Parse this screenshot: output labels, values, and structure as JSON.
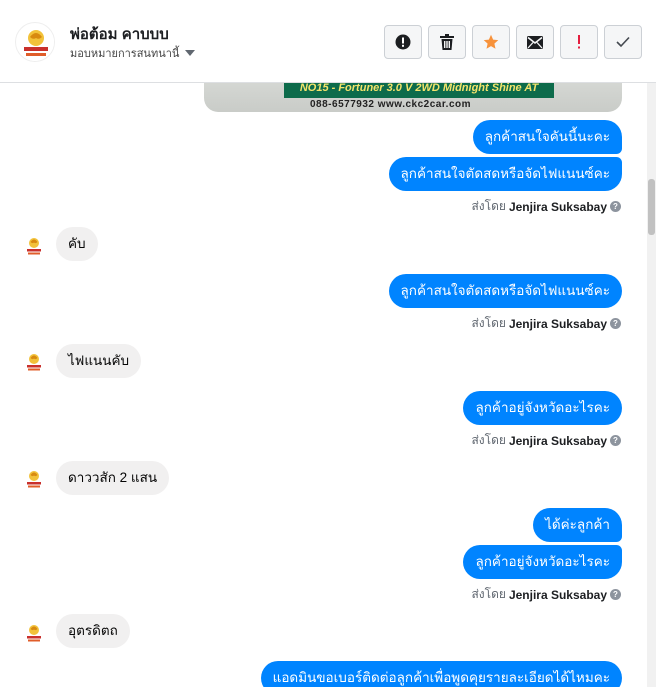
{
  "header": {
    "title": "พ่อต้อม คาบบบ",
    "subtitle": "มอบหมายการสนทนานี้",
    "icons": {
      "avatar": "dealer-logo-icon",
      "assign_dropdown": "caret-down-icon"
    },
    "toolbar": [
      {
        "name": "report-button",
        "icon": "alert-circle-icon"
      },
      {
        "name": "delete-button",
        "icon": "trash-icon"
      },
      {
        "name": "star-button",
        "icon": "star-icon"
      },
      {
        "name": "mark-unread-button",
        "icon": "envelope-icon"
      },
      {
        "name": "spam-button",
        "icon": "exclamation-icon"
      },
      {
        "name": "mark-done-button",
        "icon": "check-icon"
      }
    ]
  },
  "banner": {
    "line1": "NO15 - Fortuner 3.0 V 2WD Midnight Shine AT",
    "line2": "088-6577932  www.ckc2car.com"
  },
  "sentby_prefix": "ส่งโดย",
  "sender_name": "Jenjira Suksabay",
  "messages": {
    "m1": "ลูกค้าสนใจคันนี้นะคะ",
    "m2": "ลูกค้าสนใจตัดสดหรือจัดไฟแนนซ์คะ",
    "r1": "คับ",
    "m3": "ลูกค้าสนใจตัดสดหรือจัดไฟแนนซ์คะ",
    "r2": "ไฟแนนคับ",
    "m4": "ลูกค้าอยู่จังหวัดอะไรคะ",
    "r3": "ดาววสัก 2 แสน",
    "m5": "ได้ค่ะลูกค้า",
    "m6": "ลูกค้าอยู่จังหวัดอะไรคะ",
    "r4": "อุตรดิตถ",
    "m7": "แอดมินขอเบอร์ติดต่อลูกค้าเพื่อพูดคุยรายละเอียดได้ไหมคะ"
  },
  "colors": {
    "outgoing_bubble": "#0084ff",
    "incoming_bubble": "#f1f0f0",
    "star": "#f7923b",
    "spam": "#e41e3f"
  }
}
